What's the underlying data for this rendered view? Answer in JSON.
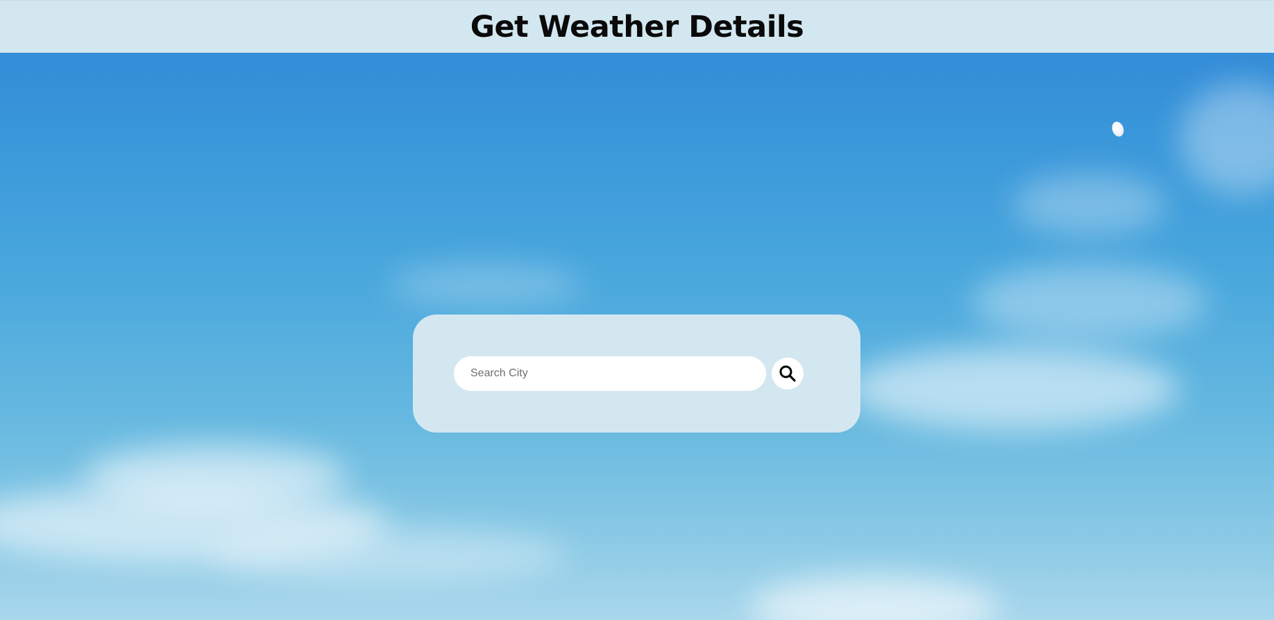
{
  "header": {
    "title": "Get Weather Details"
  },
  "search": {
    "placeholder": "Search City",
    "value": ""
  },
  "icons": {
    "search_button_icon": "search-icon"
  },
  "colors": {
    "header_bg": "#d3e7f0",
    "panel_bg": "#d3e7f0",
    "sky_top": "#2f86d6",
    "sky_bottom": "#a9d7ec"
  }
}
